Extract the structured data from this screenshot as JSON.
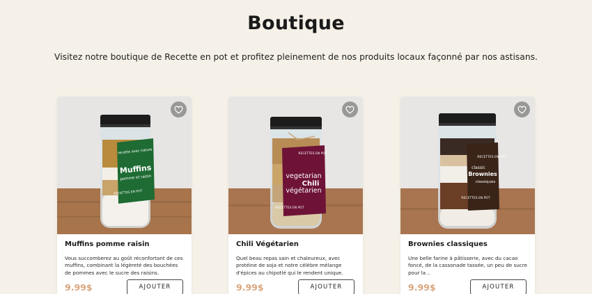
{
  "page": {
    "title": "Boutique",
    "intro": "Visitez notre boutique de Recette en pot et profitez pleinement de nos produits locaux façonné par nos astisans."
  },
  "products": [
    {
      "name": "Muffins pomme raisin",
      "description": "Vous succomberez au goût réconfortant de ces muffins, combinant la légèreté des bouchées de pommes avec le sucre des raisins.",
      "price": "9.99$",
      "button": "AJOUTER",
      "label": {
        "color": "#1f6b33",
        "brand_top": "RECETTES EN POT",
        "tagline": "recette avec nature",
        "title": "Muffins",
        "subtitle": "pomme et raisin",
        "brand_bottom": "RECETTES EN POT"
      }
    },
    {
      "name": "Chili Végétarien",
      "description": "Quel beau repas sain et chaleureux, avec protéine de soja et notre célèbre mélange d'épices au chipotlé qui le rendent unique.",
      "price": "9.99$",
      "button": "AJOUTER",
      "label": {
        "color": "#6e1337",
        "brand_top": "RECETTES EN POT",
        "title_line1": "vegetarian",
        "title_line2": "Chili",
        "title_line3": "végétarien",
        "brand_bottom": "RECETTES EN POT"
      }
    },
    {
      "name": "Brownies classiques",
      "description": "Une belle farine à pâtisserie, avec du cacao foncé, de la cassonade tassée, un peu de sucre pour la ..",
      "price": "9.99$",
      "button": "AJOUTER",
      "label": {
        "color": "#3a2418",
        "brand_top": "RECETTES EN POT",
        "title_line1": "classic",
        "title_line2": "Brownies",
        "title_line3": "classiques",
        "brand_bottom": "RECETTES EN POT"
      }
    }
  ],
  "icons": {
    "favorite": "heart-outline-icon"
  }
}
